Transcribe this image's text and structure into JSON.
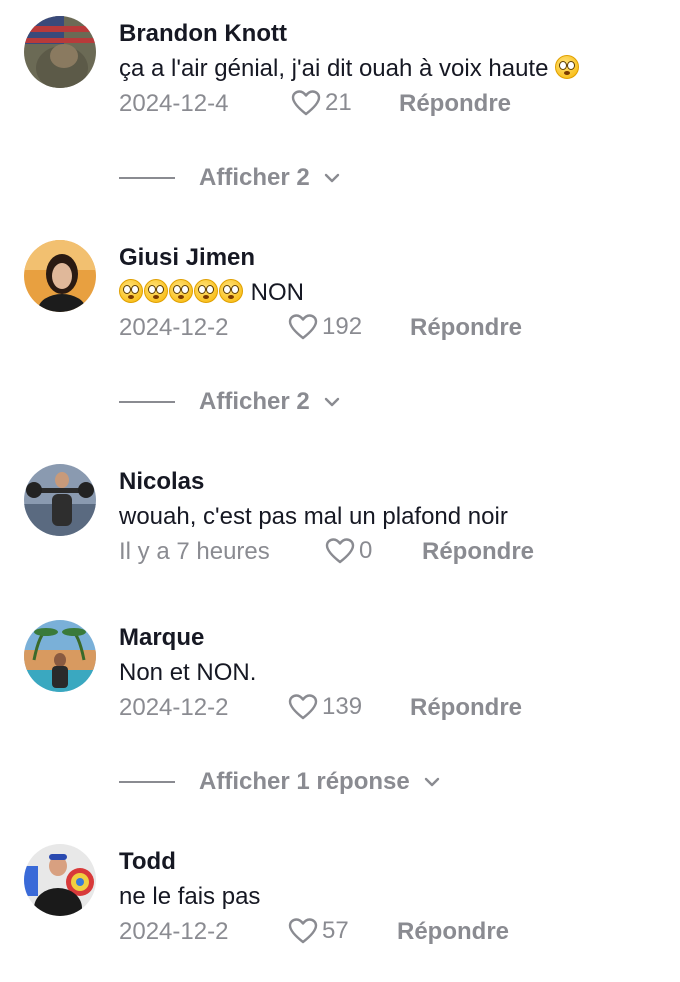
{
  "comments": [
    {
      "username": "Brandon Knott",
      "text": "ça a l'air génial, j'ai dit ouah à voix haute",
      "emoji_count": 1,
      "date": "2024-12-4",
      "likes": "21",
      "reply_label": "Répondre",
      "more_label": "Afficher 2"
    },
    {
      "username": "Giusi Jimen",
      "text": "NON",
      "emoji_count": 5,
      "date": "2024-12-2",
      "likes": "192",
      "reply_label": "Répondre",
      "more_label": "Afficher 2"
    },
    {
      "username": "Nicolas",
      "text": "wouah, c'est pas mal un plafond noir",
      "date": "Il y a 7 heures",
      "likes": "0",
      "reply_label": "Répondre"
    },
    {
      "username": "Marque",
      "text": "Non et NON.",
      "date": "2024-12-2",
      "likes": "139",
      "reply_label": "Répondre",
      "more_label": "Afficher 1 réponse"
    },
    {
      "username": "Todd",
      "text": "ne le fais pas",
      "date": "2024-12-2",
      "likes": "57",
      "reply_label": "Répondre"
    }
  ],
  "icons": {
    "like": "heart-outline-icon",
    "expand": "chevron-down-icon",
    "emoji": "flushed-face-emoji"
  },
  "colors": {
    "username": "#161823",
    "text": "#161823",
    "meta": "#8a8b91",
    "emoji": "#f7b500"
  }
}
